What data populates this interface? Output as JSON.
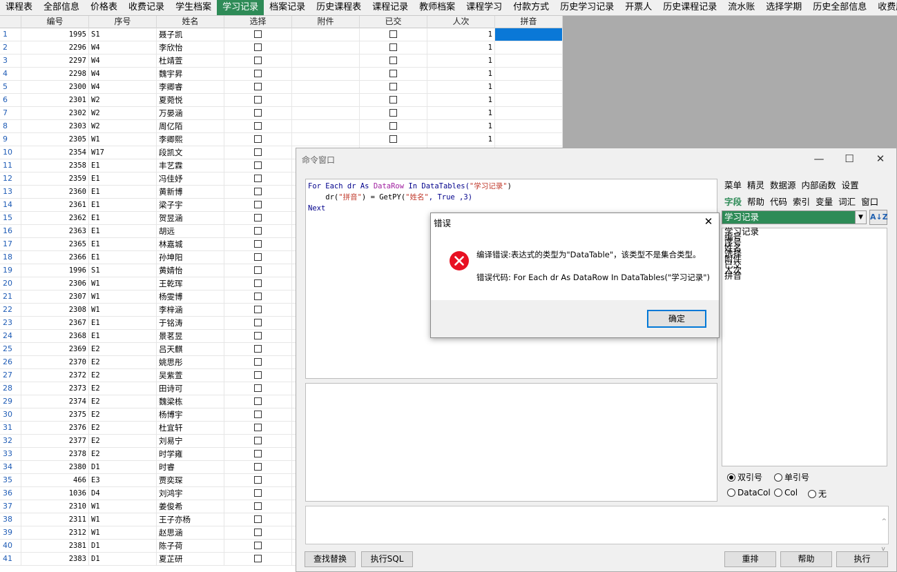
{
  "tabs": [
    "课程表",
    "全部信息",
    "价格表",
    "收费记录",
    "学生档案",
    "学习记录",
    "档案记录",
    "历史课程表",
    "课程记录",
    "教师档案",
    "课程学习",
    "付款方式",
    "历史学习记录",
    "开票人",
    "历史课程记录",
    "流水账",
    "选择学期",
    "历史全部信息",
    "收费历史"
  ],
  "active_tab": "学习记录",
  "grid": {
    "columns": [
      "编号",
      "序号",
      "姓名",
      "选择",
      "附件",
      "已交",
      "人次",
      "拼音"
    ],
    "rows": [
      [
        "1995",
        "S1",
        "聂子凯",
        "1"
      ],
      [
        "2296",
        "W4",
        "李欣怡",
        "1"
      ],
      [
        "2297",
        "W4",
        "杜靖萱",
        "1"
      ],
      [
        "2298",
        "W4",
        "魏宇昇",
        "1"
      ],
      [
        "2300",
        "W4",
        "李卿睿",
        "1"
      ],
      [
        "2301",
        "W2",
        "夏菀悦",
        "1"
      ],
      [
        "2302",
        "W2",
        "万晏涵",
        "1"
      ],
      [
        "2303",
        "W2",
        "周亿陌",
        "1"
      ],
      [
        "2305",
        "W1",
        "李卿熙",
        "1"
      ],
      [
        "2354",
        "W17",
        "段凯文",
        ""
      ],
      [
        "2358",
        "E1",
        "丰艺霖",
        ""
      ],
      [
        "2359",
        "E1",
        "冯佳妤",
        ""
      ],
      [
        "2360",
        "E1",
        "黄新博",
        ""
      ],
      [
        "2361",
        "E1",
        "梁子宇",
        ""
      ],
      [
        "2362",
        "E1",
        "贺昱涵",
        ""
      ],
      [
        "2363",
        "E1",
        "胡远",
        ""
      ],
      [
        "2365",
        "E1",
        "林嘉城",
        ""
      ],
      [
        "2366",
        "E1",
        "孙坤阳",
        ""
      ],
      [
        "1996",
        "S1",
        "黄婧怡",
        ""
      ],
      [
        "2306",
        "W1",
        "王乾珲",
        ""
      ],
      [
        "2307",
        "W1",
        "杨雯博",
        ""
      ],
      [
        "2308",
        "W1",
        "李梓涵",
        ""
      ],
      [
        "2367",
        "E1",
        "于铭涛",
        ""
      ],
      [
        "2368",
        "E1",
        "景茗昱",
        ""
      ],
      [
        "2369",
        "E2",
        "吕天麒",
        ""
      ],
      [
        "2370",
        "E2",
        "姚思彤",
        ""
      ],
      [
        "2372",
        "E2",
        "吴紫萱",
        ""
      ],
      [
        "2373",
        "E2",
        "田诗可",
        ""
      ],
      [
        "2374",
        "E2",
        "魏梁栋",
        ""
      ],
      [
        "2375",
        "E2",
        "杨博宇",
        ""
      ],
      [
        "2376",
        "E2",
        "杜宜轩",
        ""
      ],
      [
        "2377",
        "E2",
        "刘易宁",
        ""
      ],
      [
        "2378",
        "E2",
        "时学雍",
        ""
      ],
      [
        "2380",
        "D1",
        "时睿",
        ""
      ],
      [
        "466",
        "E3",
        "贾奕琛",
        ""
      ],
      [
        "1036",
        "D4",
        "刘鸿宇",
        ""
      ],
      [
        "2310",
        "W1",
        "姜俊希",
        ""
      ],
      [
        "2311",
        "W1",
        "王子亦杨",
        ""
      ],
      [
        "2312",
        "W1",
        "赵思涵",
        ""
      ],
      [
        "2381",
        "D1",
        "陈子荷",
        ""
      ],
      [
        "2383",
        "D1",
        "夏芷研",
        ""
      ]
    ]
  },
  "cmd": {
    "title": "命令窗口",
    "code": {
      "l1_for": "For Each dr As ",
      "l1_cls": "DataRow",
      "l1_in": " In DataTables(",
      "l1_str": "\"学习记录\"",
      "l1_end": ")",
      "l2_a": "    dr(",
      "l2_str1": "\"拼音\"",
      "l2_b": ") = GetPY(",
      "l2_str2": "\"姓名\"",
      "l2_c": ", True ,3)",
      "l3": "Next"
    },
    "tools_row1": [
      "菜单",
      "精灵",
      "数据源",
      "内部函数",
      "设置"
    ],
    "tools_row2": [
      "字段",
      "帮助",
      "代码",
      "索引",
      "变量",
      "词汇",
      "窗口"
    ],
    "table_select": "学习记录",
    "sort_label": "A↓Z",
    "fields": [
      "学习记录",
      "编号",
      "序号",
      "姓名",
      "选择",
      "附件",
      "已交",
      "人次",
      "拼音"
    ],
    "radio_double": "双引号",
    "radio_single": "单引号",
    "radio_datacol": "DataCol",
    "radio_col": "Col",
    "radio_none": "无",
    "btn_find": "查找替换",
    "btn_sql": "执行SQL",
    "btn_reset": "重排",
    "btn_help": "帮助",
    "btn_run": "执行"
  },
  "dialog": {
    "title": "错误",
    "message": "编译错误:表达式的类型为\"DataTable\"，该类型不是集合类型。",
    "code": "错误代码:  For Each dr As DataRow In DataTables(\"学习记录\")",
    "ok": "确定"
  },
  "colors": {
    "accent_green": "#2e8b57",
    "selection_blue": "#0a78d7",
    "error_red": "#e81123"
  }
}
